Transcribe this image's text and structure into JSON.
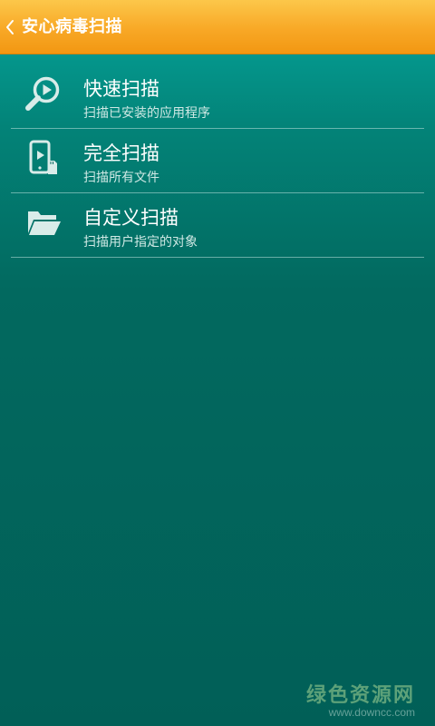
{
  "header": {
    "title": "安心病毒扫描",
    "back_icon": "chevron-left-icon",
    "bg_color": "#f8a826"
  },
  "items": [
    {
      "label": "快速扫描",
      "sub": "扫描已安装的应用程序",
      "icon": "magnifier-play-icon"
    },
    {
      "label": "完全扫描",
      "sub": "扫描所有文件",
      "icon": "phone-sdcard-icon"
    },
    {
      "label": "自定义扫描",
      "sub": "扫描用户指定的对象",
      "icon": "folder-open-icon"
    }
  ],
  "watermark": {
    "text": "绿色资源网",
    "url": "www.downcc.com"
  },
  "colors": {
    "background": "#026a60",
    "text": "#ffffff",
    "subtext": "#cfe8e4"
  }
}
